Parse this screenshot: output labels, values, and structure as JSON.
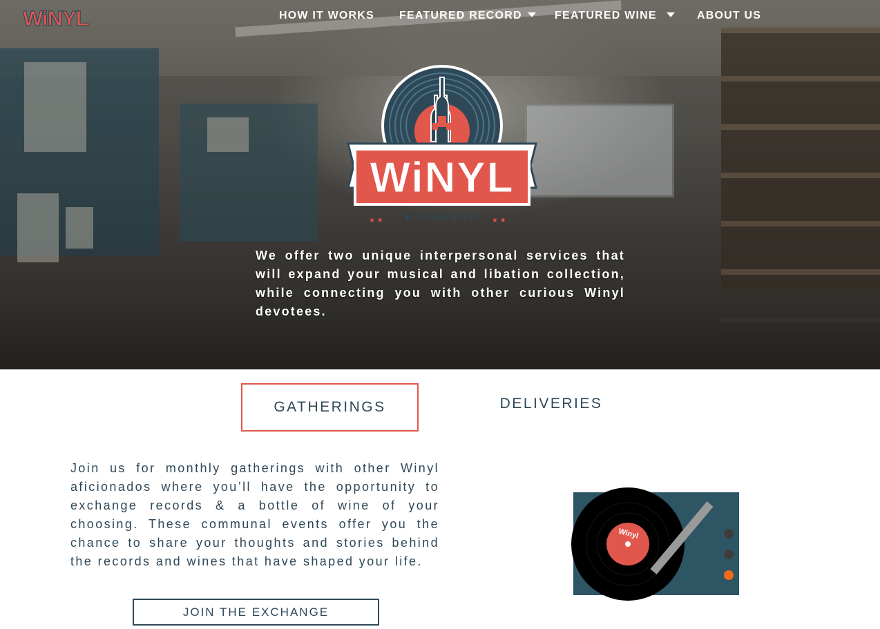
{
  "brand": {
    "logo_text": "WiNYL",
    "logo_subtext": "EXCHANGE",
    "primary_color": "#e2574c",
    "dark_color": "#2f4858"
  },
  "nav": {
    "items": [
      {
        "label": "HOW IT WORKS",
        "has_dropdown": false
      },
      {
        "label": "FEATURED RECORD",
        "has_dropdown": true
      },
      {
        "label": "FEATURED WINE",
        "has_dropdown": true
      },
      {
        "label": "ABOUT US",
        "has_dropdown": false
      }
    ]
  },
  "hero": {
    "tagline": "We offer two unique interpersonal services that will expand your musical and libation collection, while connecting you with other curious Winyl devotees."
  },
  "tabs": {
    "gatherings": "GATHERINGS",
    "deliveries": "DELIVERIES",
    "active": "gatherings"
  },
  "gatherings": {
    "description": "Join us for monthly gatherings with other Winyl aficionados where you’ll have the opportunity to exchange records & a bottle of wine of your choosing. These communal events offer you the chance to share your thoughts and stories behind the records and wines that have shaped your life.",
    "cta_label": "JOIN THE EXCHANGE"
  },
  "turntable": {
    "record_label_text": "Winyl",
    "body_color": "#2e5563",
    "knob_colors": [
      "#3d3d3d",
      "#3d3d3d",
      "#f26a1b"
    ]
  }
}
